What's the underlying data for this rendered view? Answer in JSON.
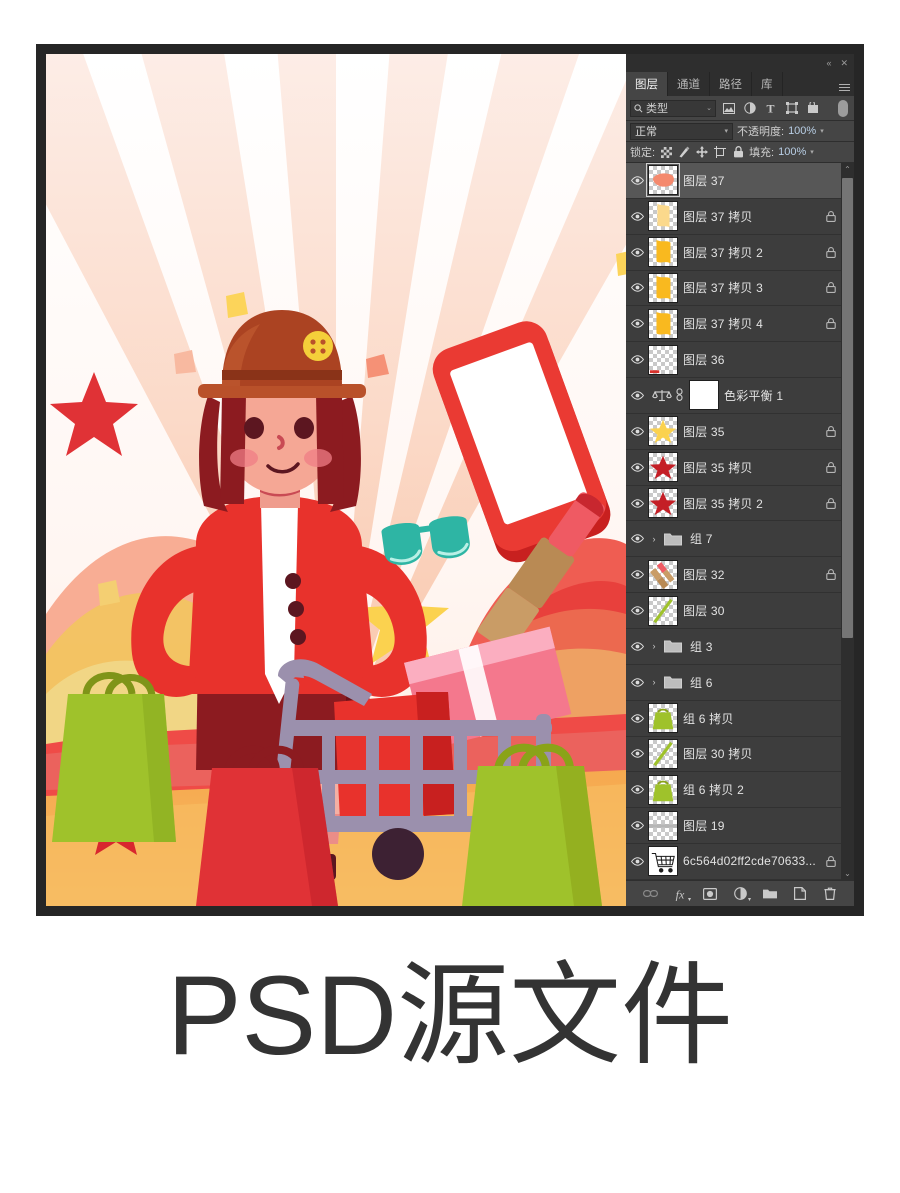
{
  "app": {
    "panel_topbar": {
      "collapse": "«",
      "close": "✕"
    },
    "tabs": [
      {
        "label": "图层",
        "active": true
      },
      {
        "label": "通道",
        "active": false
      },
      {
        "label": "路径",
        "active": false
      },
      {
        "label": "库",
        "active": false
      }
    ],
    "menu_icon": "hamburger-icon",
    "filter_row": {
      "search_icon": "search-icon",
      "kind_label": "类型",
      "caret": "⌄",
      "filter_icons": [
        "pixel-filter-icon",
        "adjustment-filter-icon",
        "type-filter-icon",
        "shape-filter-icon",
        "smart-object-filter-icon"
      ],
      "toggle": "filter-enable-toggle"
    },
    "blend_row": {
      "mode": "正常",
      "opacity_label": "不透明度:",
      "opacity_value": "100%"
    },
    "lock_row": {
      "lock_label": "锁定:",
      "lock_icons": [
        "lock-transparent-icon",
        "lock-image-icon",
        "lock-position-icon",
        "lock-artboard-icon",
        "lock-all-icon"
      ],
      "fill_label": "填充:",
      "fill_value": "100%"
    },
    "bottom_toolbar": [
      {
        "name": "link-layers-icon",
        "glyph": "⚭",
        "dim": true
      },
      {
        "name": "layer-style-fx-icon",
        "glyph": "fx",
        "caret": true
      },
      {
        "name": "layer-mask-icon",
        "glyph": "mask",
        "caret": false
      },
      {
        "name": "adjustment-layer-icon",
        "glyph": "adj",
        "caret": true
      },
      {
        "name": "new-group-icon",
        "glyph": "folder",
        "caret": false
      },
      {
        "name": "new-layer-icon",
        "glyph": "newlayer",
        "caret": false
      },
      {
        "name": "delete-layer-icon",
        "glyph": "trash",
        "caret": false
      }
    ],
    "scrollbar": {
      "up": "⌃",
      "down": "⌄"
    }
  },
  "layers": [
    {
      "name": "图层 37",
      "type": "pixel",
      "thumb": "blob-orange",
      "locked": false,
      "selected": true,
      "visible": true
    },
    {
      "name": "图层 37 拷贝",
      "type": "pixel",
      "thumb": "ribbon-pale",
      "locked": true,
      "selected": false,
      "visible": true
    },
    {
      "name": "图层 37 拷贝 2",
      "type": "pixel",
      "thumb": "ribbon-gold",
      "locked": true,
      "selected": false,
      "visible": true
    },
    {
      "name": "图层 37 拷贝 3",
      "type": "pixel",
      "thumb": "ribbon-gold",
      "locked": true,
      "selected": false,
      "visible": true
    },
    {
      "name": "图层 37 拷贝 4",
      "type": "pixel",
      "thumb": "ribbon-gold",
      "locked": true,
      "selected": false,
      "visible": true
    },
    {
      "name": "图层 36",
      "type": "pixel",
      "thumb": "empty-red-line",
      "locked": false,
      "selected": false,
      "visible": true
    },
    {
      "name": "色彩平衡 1",
      "type": "adjustment",
      "thumb": "color-balance",
      "locked": false,
      "selected": false,
      "visible": true
    },
    {
      "name": "图层 35",
      "type": "pixel",
      "thumb": "star-yellow",
      "locked": true,
      "selected": false,
      "visible": true
    },
    {
      "name": "图层 35 拷贝",
      "type": "pixel",
      "thumb": "star-red",
      "locked": true,
      "selected": false,
      "visible": true
    },
    {
      "name": "图层 35 拷贝 2",
      "type": "pixel",
      "thumb": "star-red",
      "locked": true,
      "selected": false,
      "visible": true
    },
    {
      "name": "组 7",
      "type": "group",
      "thumb": null,
      "locked": false,
      "selected": false,
      "visible": true
    },
    {
      "name": "图层 32",
      "type": "pixel",
      "thumb": "lipstick",
      "locked": true,
      "selected": false,
      "visible": true
    },
    {
      "name": "图层 30",
      "type": "pixel",
      "thumb": "handle-green",
      "locked": false,
      "selected": false,
      "visible": true
    },
    {
      "name": "组 3",
      "type": "group",
      "thumb": null,
      "locked": false,
      "selected": false,
      "visible": true
    },
    {
      "name": "组 6",
      "type": "group",
      "thumb": null,
      "locked": false,
      "selected": false,
      "visible": true
    },
    {
      "name": "组 6 拷贝",
      "type": "pixel",
      "thumb": "bag-green",
      "locked": false,
      "selected": false,
      "visible": true
    },
    {
      "name": "图层 30 拷贝",
      "type": "pixel",
      "thumb": "handle-green",
      "locked": false,
      "selected": false,
      "visible": true
    },
    {
      "name": "组 6 拷贝 2",
      "type": "pixel",
      "thumb": "bag-green",
      "locked": false,
      "selected": false,
      "visible": true
    },
    {
      "name": "图层 19",
      "type": "pixel",
      "thumb": "gray-bar",
      "locked": false,
      "selected": false,
      "visible": true
    },
    {
      "name": "6c564d02ff2cde70633...",
      "type": "pixel",
      "thumb": "cart-sketch",
      "locked": true,
      "selected": false,
      "visible": true
    }
  ],
  "caption": {
    "text": "PSD源文件"
  },
  "colors": {
    "panel_bg": "#383838",
    "row_bg": "#3d3d3d",
    "row_selected": "#575757",
    "accent_number": "#b9cfe6",
    "frame": "#262626",
    "caption_color": "#333333",
    "art_red": "#e8322c",
    "art_darkred": "#8c1b20",
    "art_green": "#9fc22b",
    "art_teal": "#2eb5a4",
    "art_gold": "#f6c342",
    "art_cart": "#9b90ad",
    "art_hat": "#b9512a",
    "art_skin": "#f0a08f"
  }
}
